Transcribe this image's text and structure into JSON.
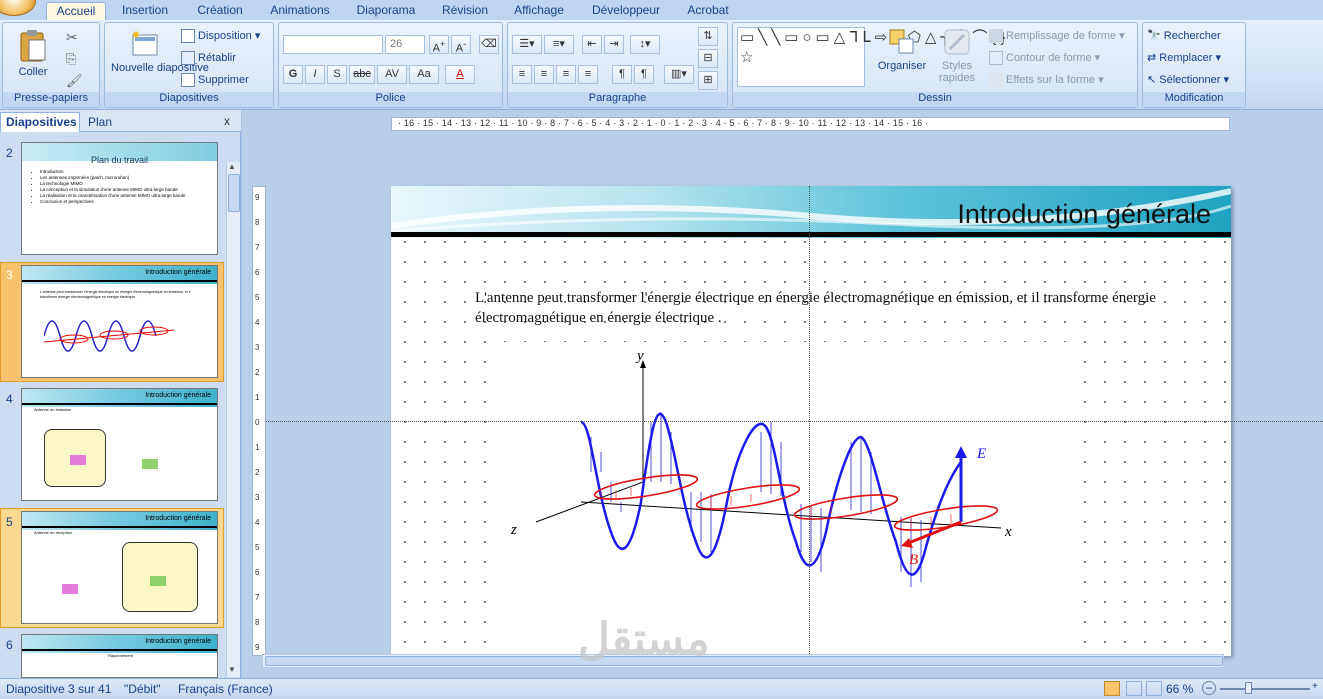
{
  "ribbon_tabs": [
    "Accueil",
    "Insertion",
    "Création",
    "Animations",
    "Diaporama",
    "Révision",
    "Affichage",
    "Développeur",
    "Acrobat"
  ],
  "active_tab": "Accueil",
  "groups": {
    "clipboard": {
      "label": "Presse-papiers",
      "paste": "Coller"
    },
    "slides": {
      "label": "Diapositives",
      "new_slide": "Nouvelle diapositive",
      "layout": "Disposition",
      "reset": "Rétablir",
      "delete": "Supprimer"
    },
    "font": {
      "label": "Police",
      "font_name": "",
      "font_size": "26",
      "bold": "G",
      "italic": "I",
      "shadow": "S",
      "strike": "abc",
      "spacing": "AV",
      "case": "Aa",
      "color": "A"
    },
    "paragraph": {
      "label": "Paragraphe"
    },
    "drawing": {
      "label": "Dessin",
      "arrange": "Organiser",
      "quick_styles": "Styles rapides",
      "fill": "Remplissage de forme",
      "outline": "Contour de forme",
      "effects": "Effets sur la forme"
    },
    "editing": {
      "label": "Modification",
      "find": "Rechercher",
      "replace": "Remplacer",
      "select": "Sélectionner"
    }
  },
  "panel": {
    "tabs": [
      "Diapositives",
      "Plan"
    ],
    "close": "x",
    "thumbnails": [
      {
        "num": "2",
        "title": "Plan du travail",
        "lines": [
          "Introduction",
          "Les antennes imprimées (patch, microruban)",
          "La technologie MIMO",
          "La conception et la simulation d'une antenne MIMO ultra-large bande",
          "La réalisation et la caractérisation d'une antenne MIMO ultra-large bande",
          "Conclusion et perspectives"
        ]
      },
      {
        "num": "3",
        "title": "Introduction générale",
        "caption": "L'antenne peut transformer l'énergie électrique en énergie électromagnétique en émission, et il transforme énergie électromagnétique en énergie électrique ."
      },
      {
        "num": "4",
        "title": "Introduction générale",
        "caption": "Antenne en émission"
      },
      {
        "num": "5",
        "title": "Introduction générale",
        "caption": "Antenne en réception"
      },
      {
        "num": "6",
        "title": "Introduction générale",
        "caption": "Rayonnement"
      }
    ]
  },
  "ruler": {
    "h_ticks": "· 16 · 15 · 14 · 13 · 12 · 11 · 10 · 9 · 8 · 7 · 6 · 5 · 4 · 3 · 2 · 1 · 0 · 1 · 2 · 3 · 4 · 5 · 6 · 7 · 8 · 9 · 10 · 11 · 12 · 13 · 14 · 15 · 16 ·",
    "v_ticks": [
      "9",
      "8",
      "7",
      "6",
      "5",
      "4",
      "3",
      "2",
      "1",
      "0",
      "1",
      "2",
      "3",
      "4",
      "5",
      "6",
      "7",
      "8",
      "9"
    ]
  },
  "slide": {
    "title": "Introduction générale",
    "body": "L'antenne peut transformer l'énergie électrique en énergie électromagnétique en émission, et il transforme énergie électromagnétique en énergie électrique .",
    "figure_labels": {
      "y": "y",
      "z": "z",
      "x": "x",
      "E": "E",
      "B": "B"
    }
  },
  "status": {
    "slide_info": "Diapositive 3 sur 41",
    "theme": "\"Débit\"",
    "language": "Français (France)",
    "zoom": "66 %"
  },
  "watermark": "مستقل"
}
